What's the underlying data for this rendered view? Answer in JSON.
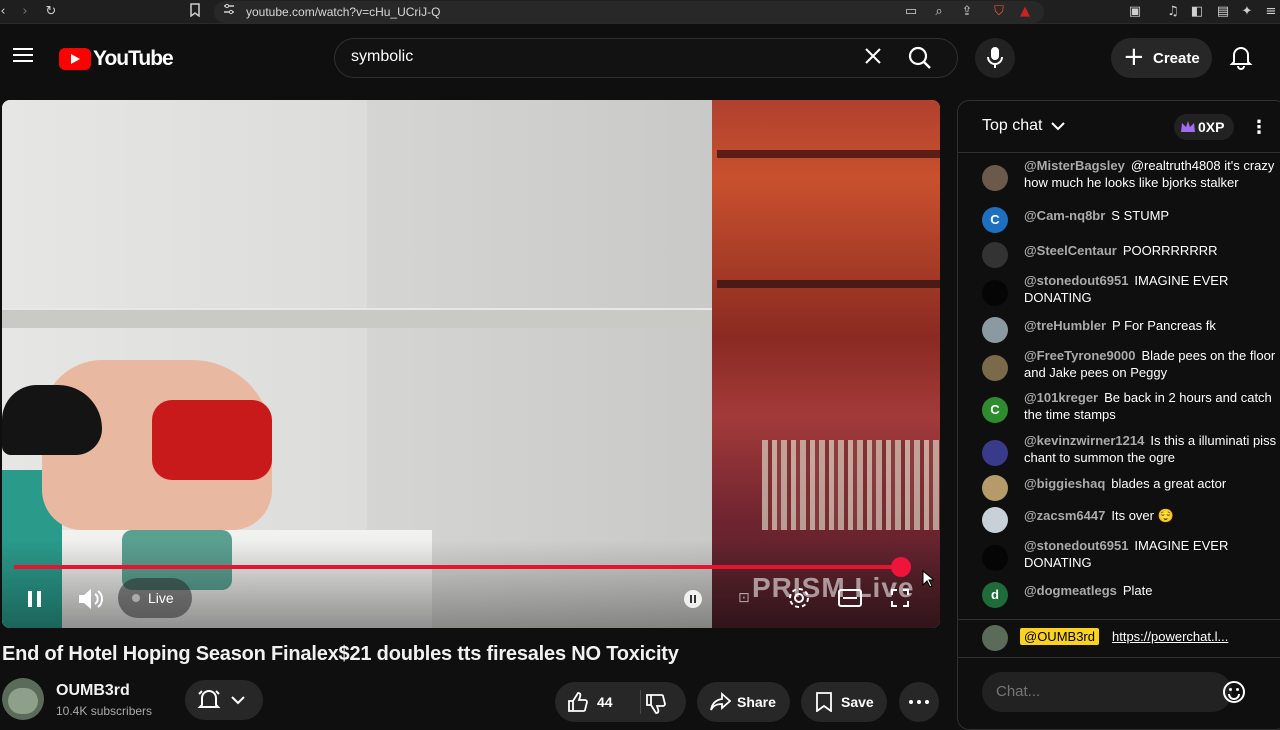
{
  "browser": {
    "url": "youtube.com/watch?v=cHu_UCriJ-Q"
  },
  "header": {
    "logo_text": "YouTube",
    "search_value": "symbolic",
    "create_label": "Create"
  },
  "player": {
    "live_label": "Live",
    "watermark": "PRISM Live",
    "progress_fraction": 0.99
  },
  "video": {
    "title": "End of Hotel Hoping Season Finalex$21 doubles tts firesales NO Toxicity",
    "channel_name": "OUMB3rd",
    "subscribers": "10.4K subscribers",
    "like_count": "44",
    "share_label": "Share",
    "save_label": "Save"
  },
  "chat": {
    "mode_label": "Top chat",
    "xp_label": "0XP",
    "messages": [
      {
        "author": "@MisterBagsley",
        "text": "@realtruth4808 it's crazy how much he looks like bjorks stalker",
        "avatar_letter": "",
        "avatar_color": "#6b5a4a"
      },
      {
        "author": "@Cam-nq8br",
        "text": "S STUMP",
        "avatar_letter": "C",
        "avatar_color": "#1e6fbf"
      },
      {
        "author": "@SteelCentaur",
        "text": "POORRRRRRR",
        "avatar_letter": "",
        "avatar_color": "#333333"
      },
      {
        "author": "@stonedout6951",
        "text": "IMAGINE EVER DONATING",
        "avatar_letter": "",
        "avatar_color": "#050505"
      },
      {
        "author": "@treHumbler",
        "text": "P For Pancreas fk",
        "avatar_letter": "",
        "avatar_color": "#8a9aa0"
      },
      {
        "author": "@FreeTyrone9000",
        "text": "Blade pees on the floor and Jake pees on Peggy",
        "avatar_letter": "",
        "avatar_color": "#7a6a4a"
      },
      {
        "author": "@101kreger",
        "text": "Be back in 2 hours and catch the time stamps",
        "avatar_letter": "C",
        "avatar_color": "#2e8b2e"
      },
      {
        "author": "@kevinzwirner1214",
        "text": "Is this a illuminati piss chant to summon the ogre",
        "avatar_letter": "",
        "avatar_color": "#3a3a8a"
      },
      {
        "author": "@biggieshaq",
        "text": "blades a great actor",
        "avatar_letter": "",
        "avatar_color": "#b59a6a"
      },
      {
        "author": "@zacsm6447",
        "text": "Its over 😌",
        "avatar_letter": "",
        "avatar_color": "#c8d0d8"
      },
      {
        "author": "@stonedout6951",
        "text": "IMAGINE EVER DONATING",
        "avatar_letter": "",
        "avatar_color": "#050505"
      },
      {
        "author": "@dogmeatlegs",
        "text": "Plate",
        "avatar_letter": "d",
        "avatar_color": "#1f6b3a"
      }
    ],
    "pinned_author": "@OUMB3rd",
    "pinned_link": "https://powerchat.l...",
    "input_placeholder": "Chat..."
  }
}
